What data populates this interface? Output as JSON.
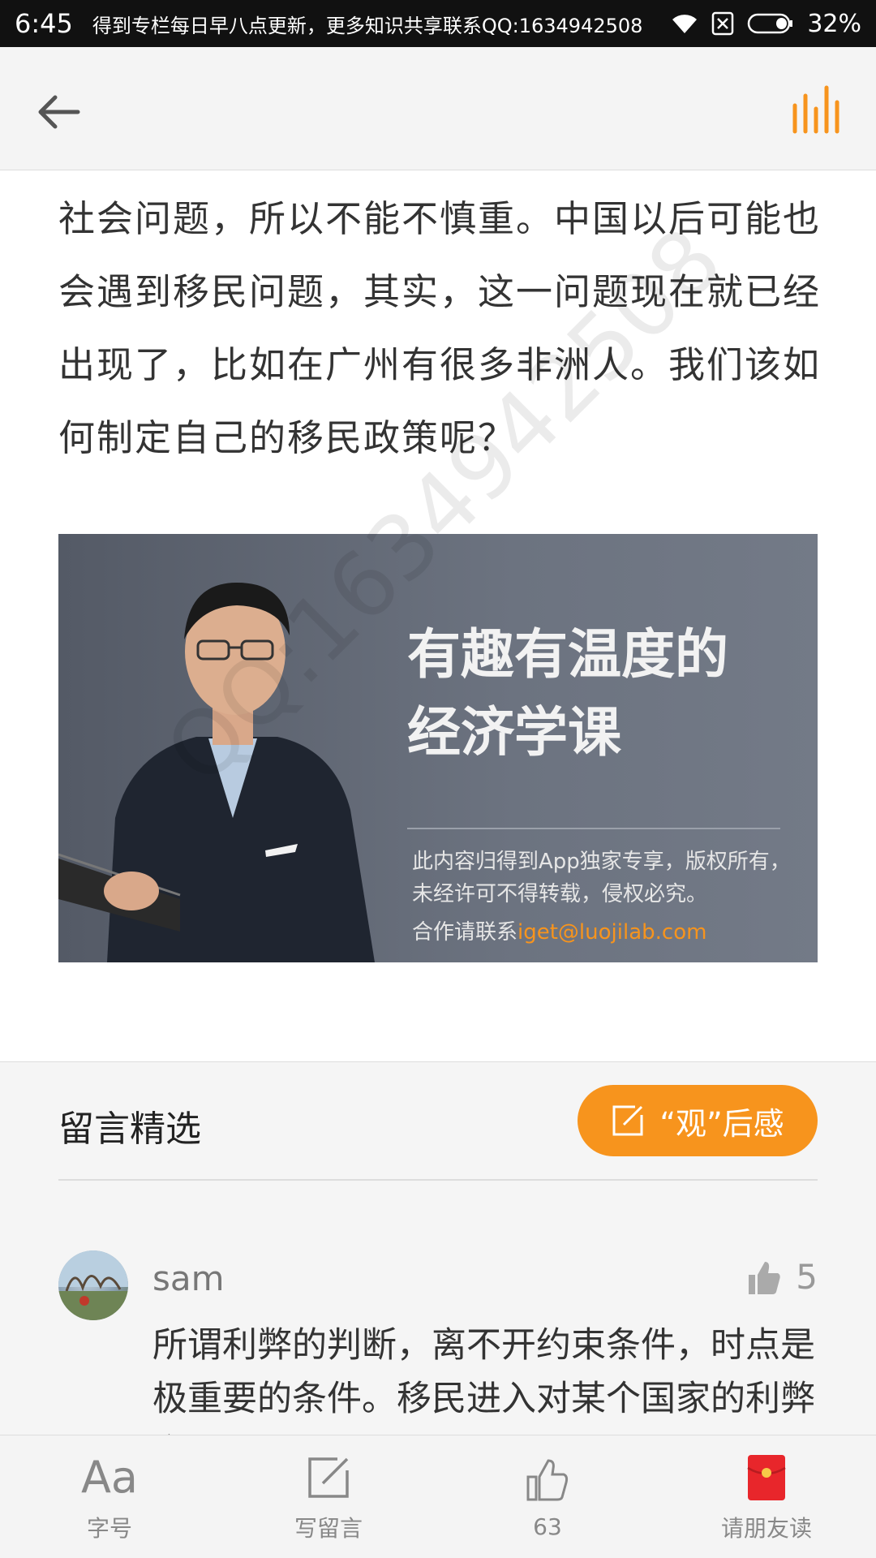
{
  "status_bar": {
    "time": "6:45",
    "notice": "得到专栏每日早八点更新，更多知识共享联系QQ:1634942508",
    "battery": "32%"
  },
  "article": {
    "text": "社会问题，所以不能不慎重。中国以后可能也会遇到移民问题，其实，这一问题现在就已经出现了，比如在广州有很多非洲人。我们该如何制定自己的移民政策呢？"
  },
  "banner": {
    "title_line1": "有趣有温度的",
    "title_line2": "经济学课",
    "notice": "此内容归得到App独家专享，版权所有，未经许可不得转载，侵权必究。",
    "contact_label": "合作请联系",
    "contact_email": "iget@luojilab.com"
  },
  "watermark": "QQ:1634942508",
  "comments": {
    "title": "留言精选",
    "review_button": "“观”后感",
    "items": [
      {
        "user": "sam",
        "likes": "5",
        "text": "所谓利弊的判断，离不开约束条件，时点是极重要的条件。移民进入对某个国家的利弊之所"
      }
    ]
  },
  "toolbar": {
    "font_label": "字号",
    "font_glyph": "Aa",
    "comment_label": "写留言",
    "likes_label": "63",
    "share_label": "请朋友读"
  },
  "colors": {
    "accent": "#f7941d",
    "status_bar": "#111111",
    "share_red": "#e8262b"
  }
}
